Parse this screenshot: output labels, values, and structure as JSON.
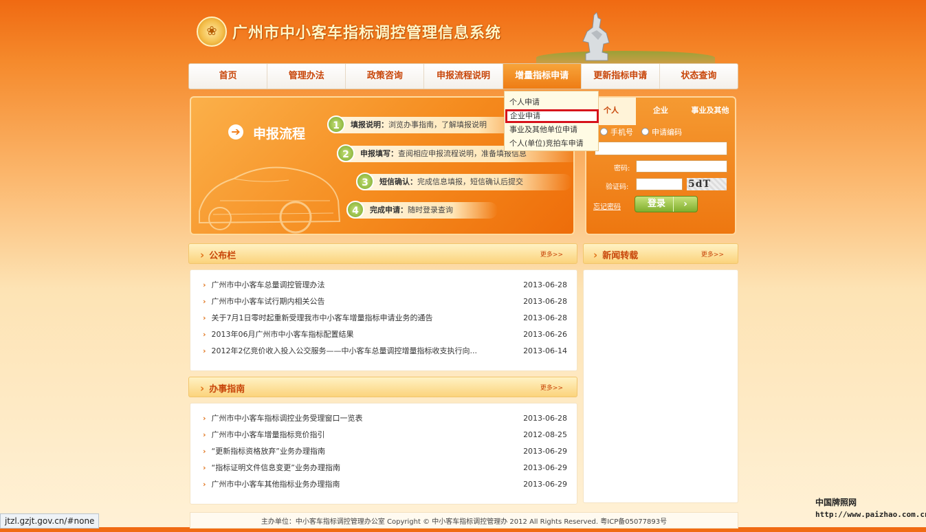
{
  "header": {
    "site_title": "广州市中小客车指标调控管理信息系统",
    "emblem_icon": "city-emblem"
  },
  "nav": {
    "items": [
      "首页",
      "管理办法",
      "政策咨询",
      "申报流程说明",
      "增量指标申请",
      "更新指标申请",
      "状态查询"
    ],
    "active_index": 4
  },
  "dropdown": {
    "items": [
      "个人申请",
      "企业申请",
      "事业及其他单位申请",
      "个人(单位)竞拍车申请"
    ],
    "highlight_index": 1,
    "highlight_color": "#d6121a"
  },
  "banner": {
    "title": "申报流程",
    "steps": [
      {
        "num": "1",
        "label": "填报说明：",
        "text": "浏览办事指南，了解填报说明"
      },
      {
        "num": "2",
        "label": "申报填写：",
        "text": "查阅相应申报流程说明，准备填报信息"
      },
      {
        "num": "3",
        "label": "短信确认：",
        "text": "完成信息填报，短信确认后提交"
      },
      {
        "num": "4",
        "label": "完成申请：",
        "text": "随时登录查询"
      }
    ]
  },
  "login": {
    "tabs": [
      "个人",
      "企业",
      "事业及其他"
    ],
    "active_tab": 0,
    "radio_phone": "手机号",
    "radio_code": "申请编码",
    "password_label": "密码:",
    "captcha_label": "验证码:",
    "captcha_text": "5dT",
    "forgot": "忘记密码",
    "button": "登录"
  },
  "notice": {
    "title": "公布栏",
    "more": "更多>>",
    "rows": [
      {
        "title": "广州市中小客车总量调控管理办法",
        "date": "2013-06-28"
      },
      {
        "title": "广州市中小客车试行期内相关公告",
        "date": "2013-06-28"
      },
      {
        "title": "关于7月1日零时起重新受理我市中小客车增量指标申请业务的通告",
        "date": "2013-06-28"
      },
      {
        "title": "2013年06月广州市中小客车指标配置结果",
        "date": "2013-06-26"
      },
      {
        "title": "2012年2亿竞价收入投入公交服务——中小客车总量调控增量指标收支执行向...",
        "date": "2013-06-14"
      }
    ]
  },
  "news": {
    "title": "新闻转载",
    "more": "更多>>"
  },
  "guide": {
    "title": "办事指南",
    "more": "更多>>",
    "rows": [
      {
        "title": "广州市中小客车指标调控业务受理窗口一览表",
        "date": "2013-06-28"
      },
      {
        "title": "广州市中小客车增量指标竞价指引",
        "date": "2012-08-25"
      },
      {
        "title": "“更新指标资格放弃”业务办理指南",
        "date": "2013-06-29"
      },
      {
        "title": "“指标证明文件信息变更”业务办理指南",
        "date": "2013-06-29"
      },
      {
        "title": "广州市中小客车其他指标业务办理指南",
        "date": "2013-06-29"
      }
    ]
  },
  "footer": {
    "text": "主办单位：中小客车指标调控管理办公室  Copyright ©  中小客车指标调控管理办  2012  All Rights Reserved.  粤ICP备05077893号"
  },
  "statusbar": {
    "url": "jtzl.gzjt.gov.cn/#none"
  },
  "watermark": {
    "line1": "中国牌照网",
    "line2": "http://www.paizhao.com.cn"
  }
}
